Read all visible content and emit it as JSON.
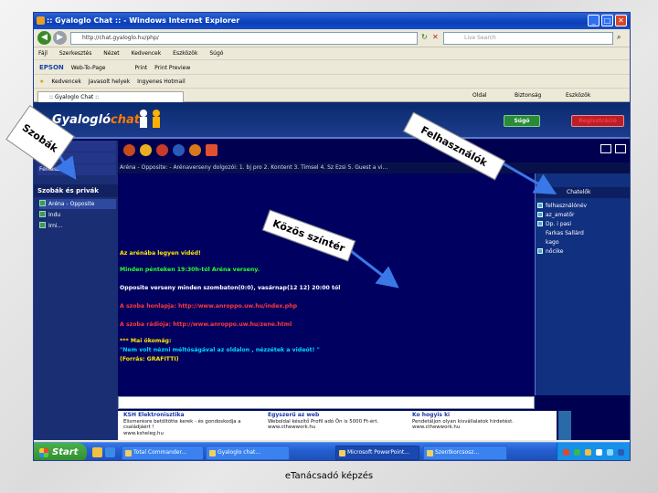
{
  "browser": {
    "title": ":: Gyaloglo Chat :: - Windows Internet Explorer",
    "url": "http://chat.gyaloglo.hu/php/",
    "search_placeholder": "Live Search",
    "menu": [
      "Fájl",
      "Szerkesztés",
      "Nézet",
      "Kedvencek",
      "Eszközök",
      "Súgó"
    ],
    "toolbar_epson": "EPSON",
    "toolbar_webtoprint": "Web-To-Page",
    "toolbar_items2": [
      "Print",
      "Print Preview"
    ],
    "toolbar_items3": [
      "Kedvencek",
      "Javasolt helyek",
      "Ingyenes Hotmail"
    ],
    "tab_label": ":: Gyaloglo Chat ::",
    "right_tools": [
      "Oldal",
      "Biztonság",
      "Eszközök"
    ]
  },
  "site": {
    "logo_text": "Gyalogló",
    "logo_accent": "chat",
    "help_button": "Súgó",
    "register_button": "Regisztráció",
    "left_links": [
      "...",
      "...",
      "Felhasználók"
    ],
    "rooms_header": "Szobák és privák",
    "rooms": [
      "Aréna - Opposite",
      "Indu",
      "Irni..."
    ],
    "channel_bar": "Aréna - Opposite: - Arénaverseny dolgozói: 1. bj pro 2. Kontent 3. Timsel 4. Sz Ezsi 5. Guest a vi...",
    "users_header": "Chatelők",
    "users": [
      {
        "name": "felhasználónév",
        "icon": true
      },
      {
        "name": "az_amatőr",
        "icon": true
      },
      {
        "name": "Dp. i pasi",
        "icon": true
      },
      {
        "name": "Farkas Sallárd",
        "icon": false
      },
      {
        "name": "kago",
        "icon": false
      },
      {
        "name": "nőcike",
        "icon": true
      }
    ],
    "chat_lines": [
      {
        "text": "Az arénába legyen vidéd!",
        "cls": "yel"
      },
      {
        "text": "Minden pénteken 19:30h-tól Aréna verseny.",
        "cls": "grn"
      },
      {
        "text": "Opposite verseny minden szombaton(0:0), vasárnap(12 12) 20:00 tól",
        "cls": "wht"
      },
      {
        "text": "A szoba honlapja: http://www.anroppo.uw.hu/index.php",
        "cls": "red"
      },
      {
        "text": "A szoba rádiója: http://www.anroppo.uw.hu/zene.html",
        "cls": "red"
      },
      {
        "text": "*** Mai ökomág:",
        "cls": "yel"
      },
      {
        "text": "\"Nem volt nézni méltóságával az oldalon , nézzétek a videót! \"",
        "cls": "cya"
      },
      {
        "text": "(Forrás: GRAFITTI)",
        "cls": "yel"
      }
    ],
    "ads": [
      {
        "title": "KSH Elektronisztika",
        "body": "Elismerésre betöltötte kerek - és gondoskodja a családjáért !",
        "link": "www.ksheleg.hu"
      },
      {
        "title": "Egyszerű az web",
        "body": "Weboldal készítő Profil adó Ön is 5000 Ft-ért. www.cthewwork.hu",
        "link": "www.cthewwork.hu"
      },
      {
        "title": "Ko hogyis ki",
        "body": "Pendetáljon olyan kisvállalatok hirdetést.",
        "link": "www.cthewwork.hu"
      }
    ]
  },
  "taskbar": {
    "start": "Start",
    "tasks": [
      "Total Commander...",
      "Gyaloglo chat...",
      "Microsoft PowerPoint...",
      "Szentkorcsosz..."
    ],
    "active_index": 2
  },
  "overlays": {
    "rooms_label": "Szobák",
    "users_label": "Felhasználók",
    "common_label": "Közös színtér"
  },
  "caption": "eTanácsadó képzés"
}
